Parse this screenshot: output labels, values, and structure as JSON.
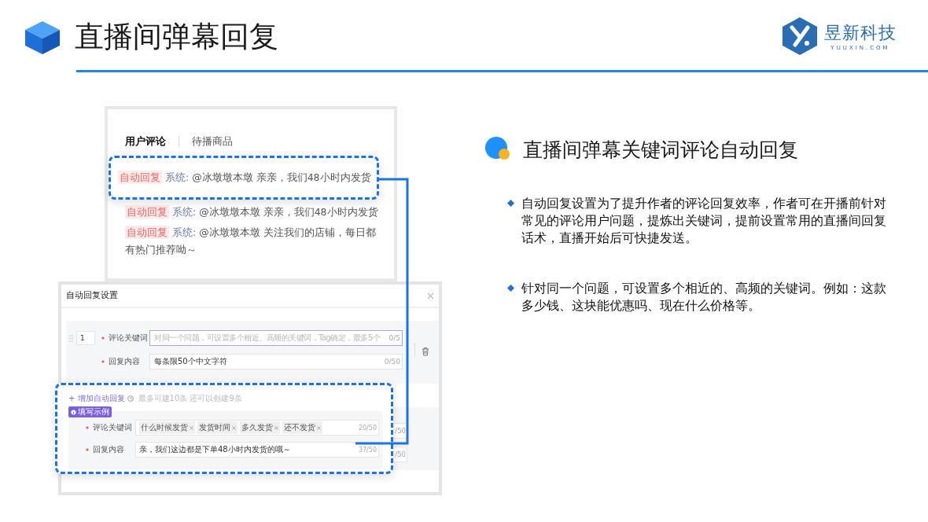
{
  "header": {
    "title": "直播间弹幕回复",
    "logo": {
      "name": "昱新科技",
      "domain": "YUUXIN.COM"
    }
  },
  "comment_panel": {
    "tabs": [
      {
        "label": "用户评论",
        "selected": true
      },
      {
        "label": "待播商品",
        "selected": false
      }
    ],
    "highlighted_comment": {
      "tag": "自动回复",
      "sender": "系统:",
      "text": "@冰墩墩本墩 亲亲，我们48小时内发货"
    },
    "comments": [
      {
        "tag": "自动回复",
        "sender": "系统:",
        "text": "@冰墩墩本墩 亲亲，我们48小时内发货"
      },
      {
        "tag": "自动回复",
        "sender": "系统:",
        "text": "@冰墩墩本墩 关注我们的店铺，每日都有热门推荐呦～"
      }
    ]
  },
  "dialog": {
    "title": "自动回复设置",
    "rule": {
      "index": "1",
      "keyword_label": "评论关键词",
      "keyword_placeholder": "对同一个问题，可设置多个相近、高频的关键词，Tag确定，最多5个",
      "keyword_count": "0/5",
      "reply_label": "回复内容",
      "reply_value": "每条限50个中文字符",
      "reply_count": "0/50"
    },
    "peek_counts": [
      "/50",
      "/50"
    ]
  },
  "example": {
    "add_link": "+ 增加自动回复",
    "add_hint": "最多可建10条 还可以创建9条",
    "badge": "填写示例",
    "keyword_label": "评论关键词",
    "tags": [
      "什么时候发货",
      "发货时间",
      "多久发货",
      "还不发货"
    ],
    "keyword_count": "20/50",
    "reply_label": "回复内容",
    "reply_value": "亲，我们这边都是下单48小时内发货的哦～",
    "reply_count": "37/50"
  },
  "description": {
    "heading": "直播间弹幕关键词评论自动回复",
    "bullets": [
      "自动回复设置为了提升作者的评论回复效率，作者可在开播前针对常见的评论用户问题，提炼出关键词，提前设置常用的直播间回复话术，直播开始后可快捷发送。",
      "针对同一个问题，可设置多个相近的、高频的关键词。例如：这款多少钱、这块能优惠吗、现在什么价格等。"
    ]
  }
}
